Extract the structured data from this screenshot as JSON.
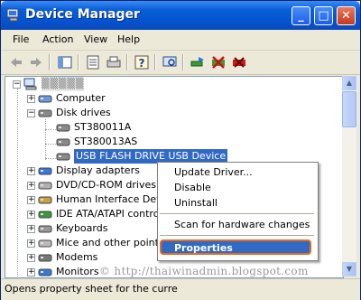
{
  "window": {
    "title": "Device Manager"
  },
  "menubar": {
    "items": [
      "File",
      "Action",
      "View",
      "Help"
    ]
  },
  "toolbar": {
    "icons": [
      "back-icon",
      "forward-icon",
      "console-tree-icon",
      "properties-icon",
      "print-icon",
      "help-icon",
      "scan-icon",
      "update-driver-icon",
      "disable-icon",
      "uninstall-icon"
    ]
  },
  "tree": {
    "root": "",
    "items": [
      {
        "label": "Computer",
        "icon": "computer-icon"
      },
      {
        "label": "Disk drives",
        "icon": "disk-drive-icon"
      },
      {
        "label": "ST380011A",
        "icon": "disk-drive-icon"
      },
      {
        "label": "ST380013AS",
        "icon": "disk-drive-icon"
      },
      {
        "label": "USB FLASH DRIVE USB Device",
        "icon": "disk-drive-icon"
      },
      {
        "label": "Display adapters",
        "icon": "display-icon"
      },
      {
        "label": "DVD/CD-ROM drives",
        "icon": "cdrom-icon"
      },
      {
        "label": "Human Interface Devic",
        "icon": "hid-icon"
      },
      {
        "label": "IDE ATA/ATAPI contro",
        "icon": "ide-icon"
      },
      {
        "label": "Keyboards",
        "icon": "keyboard-icon"
      },
      {
        "label": "Mice and other pointin",
        "icon": "mouse-icon"
      },
      {
        "label": "Modems",
        "icon": "modem-icon"
      },
      {
        "label": "Monitors",
        "icon": "monitor-icon"
      }
    ]
  },
  "context_menu": {
    "update_driver": "Update Driver...",
    "disable": "Disable",
    "uninstall": "Uninstall",
    "scan": "Scan for hardware changes",
    "properties": "Properties"
  },
  "status": {
    "text": "Opens property sheet for the curre"
  },
  "watermark": "© http://thaiwinadmin.blogspot.com",
  "colors": {
    "selection": "#316ac5",
    "titlebar": "#0453d0",
    "highlight_border": "#e86b1a"
  }
}
